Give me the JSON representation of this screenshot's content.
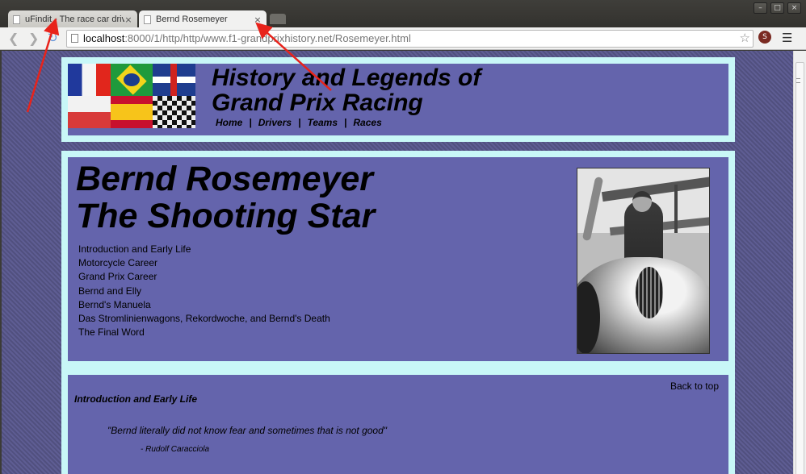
{
  "browser": {
    "tabs": [
      {
        "title": "uFindit - The race car driv",
        "active": false,
        "close": "×"
      },
      {
        "title": "Bernd Rosemeyer",
        "active": true,
        "close": "×"
      }
    ],
    "window_buttons": [
      "–",
      "□",
      "×"
    ],
    "url_host": "localhost",
    "url_rest": ":8000/1/http/http/www.f1-grandprixhistory.net/Rosemeyer.html",
    "icons": {
      "back": "back-arrow-icon",
      "forward": "forward-arrow-icon",
      "reload": "reload-icon",
      "bookmark": "star-icon",
      "extension": "extension-icon",
      "menu": "hamburger-menu-icon"
    }
  },
  "header": {
    "title_line1": "History and Legends of",
    "title_line2": "Grand Prix Racing",
    "nav": [
      "Home",
      "Drivers",
      "Teams",
      "Races"
    ],
    "nav_separator": "|"
  },
  "bio": {
    "title_line1": "Bernd Rosemeyer",
    "title_line2": "The Shooting Star",
    "toc": [
      "Introduction and Early Life",
      "Motorcycle Career",
      "Grand Prix Career",
      "Bernd and Elly",
      "Bernd's Manuela",
      "Das Stromlinienwagons, Rekordwoche, and Bernd's Death",
      "The Final Word"
    ]
  },
  "section": {
    "back_to_top": "Back to top",
    "heading": "Introduction and Early Life",
    "quote": "\"Bernd literally did not know fear and sometimes that is not good\"",
    "quote_author": "- Rudolf Caracciola"
  },
  "colors": {
    "panel": "#6464ac",
    "frame": "#c8f7f7",
    "annotation": "#e8231b"
  }
}
